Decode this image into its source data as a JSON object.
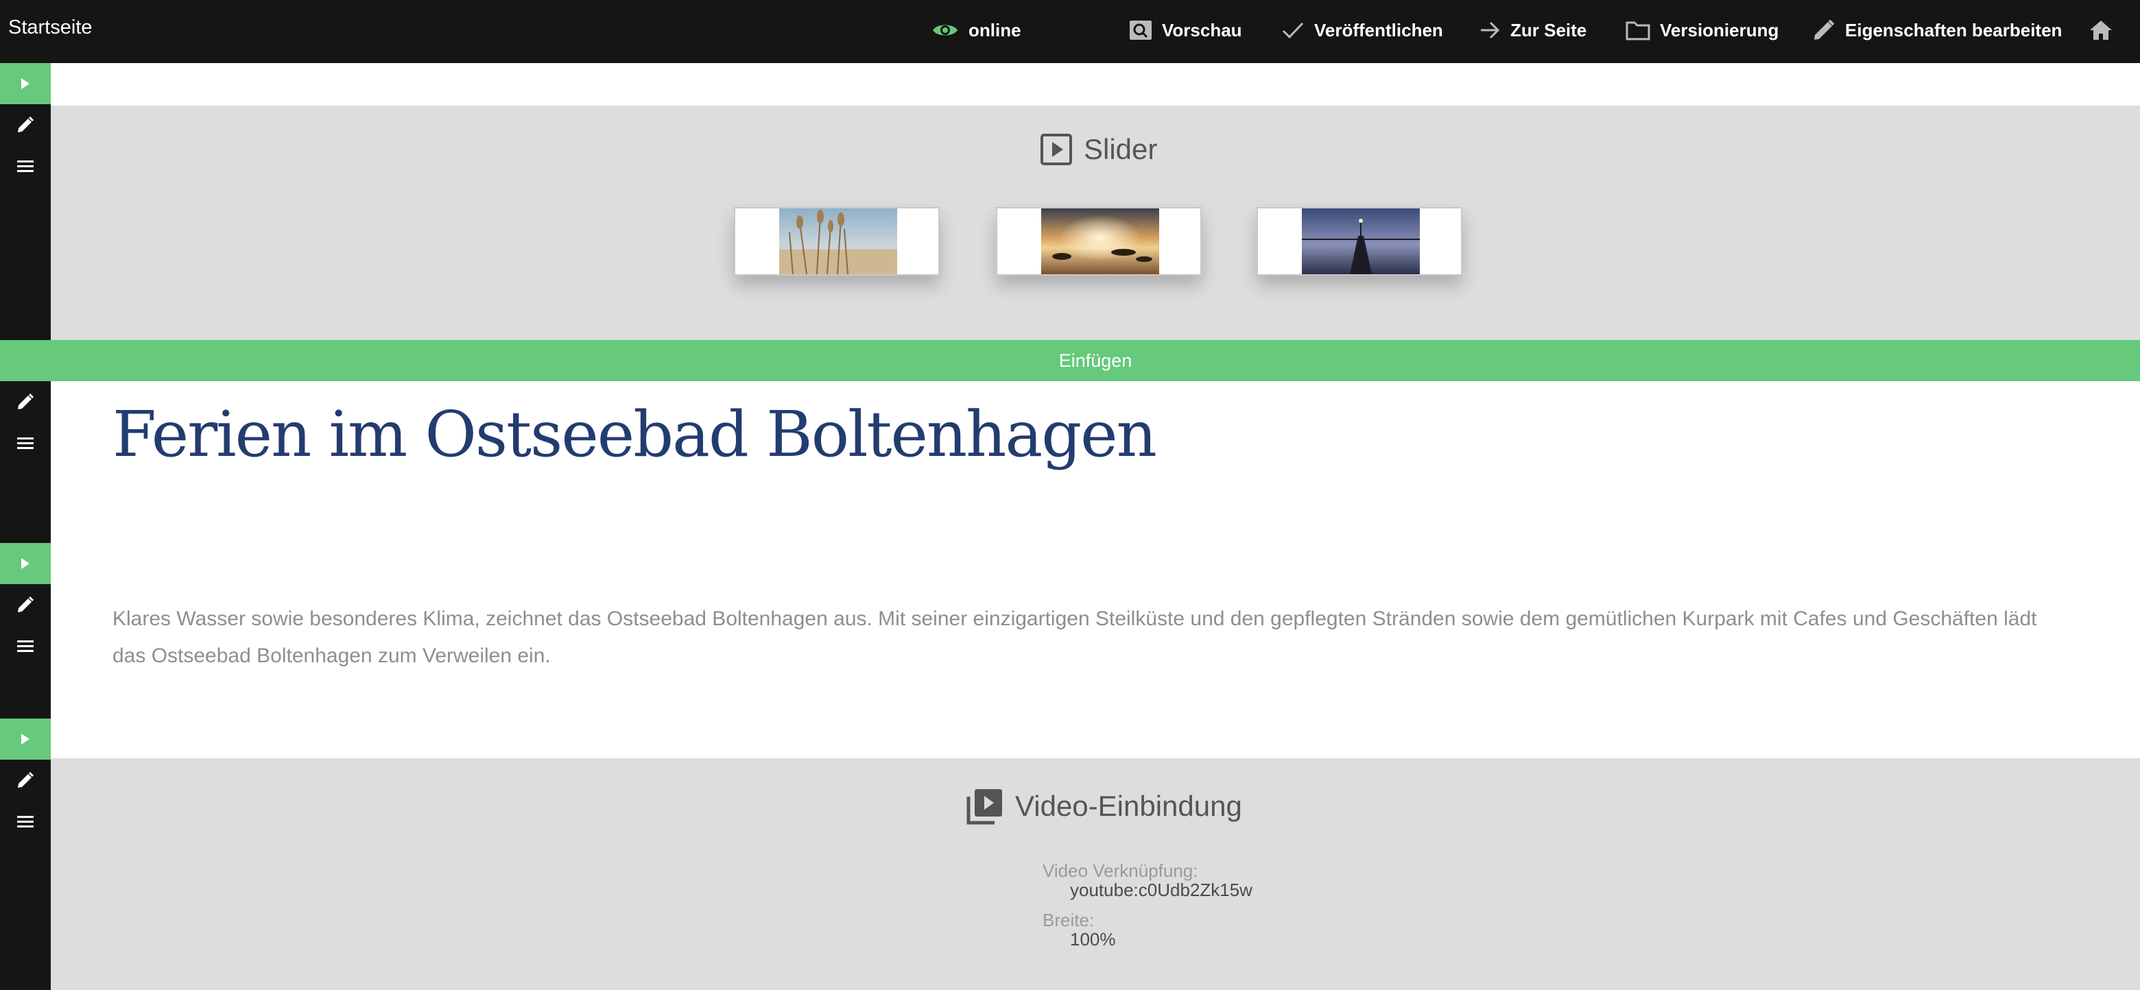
{
  "topbar": {
    "title": "Startseite",
    "status_label": "online",
    "preview_label": "Vorschau",
    "publish_label": "Veröffentlichen",
    "goto_label": "Zur Seite",
    "versioning_label": "Versionierung",
    "properties_label": "Eigenschaften bearbeiten",
    "status_color": "#66c97c"
  },
  "accent_color": "#66c97c",
  "slider": {
    "heading": "Slider",
    "thumbnails": [
      "reeds-beach",
      "sunset-beach",
      "pier-dusk"
    ]
  },
  "insert_bar": {
    "label": "Einfügen"
  },
  "content": {
    "headline": "Ferien im Ostseebad Boltenhagen",
    "paragraph": "Klares Wasser sowie besonderes Klima, zeichnet das Ostseebad Boltenhagen aus. Mit seiner einzigartigen Steilküste und den gepflegten Stränden sowie dem gemütlichen Kurpark mit Cafes und Geschäften lädt das Ostseebad Boltenhagen zum Verweilen ein."
  },
  "video": {
    "heading": "Video-Einbindung",
    "link_label": "Video Verknüpfung:",
    "link_value": "youtube:c0Udb2Zk15w",
    "width_label": "Breite:",
    "width_value": "100%"
  }
}
